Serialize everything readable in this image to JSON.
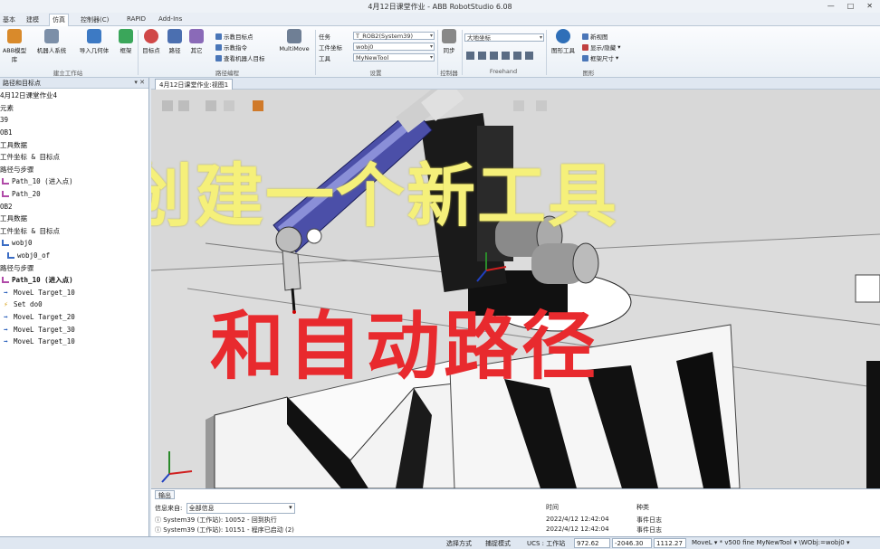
{
  "window": {
    "title": "4月12日课堂作业 - ABB RobotStudio 6.08",
    "min": "—",
    "max": "□",
    "close": "✕"
  },
  "menu_tabs": [
    "基本",
    "建模",
    "仿真",
    "控制器(C)",
    "RAPID",
    "Add-Ins"
  ],
  "ribbon": {
    "build_station": {
      "label": "建立工作站",
      "buttons": [
        "ABB模型库",
        "机器人系统",
        "导入几何体",
        "框架"
      ]
    },
    "path_programming": {
      "label": "路径编程",
      "buttons": [
        "目标点",
        "路径",
        "其它"
      ],
      "small_buttons": [
        "示教目标点",
        "示教指令",
        "查看机器人目标"
      ],
      "multimove": "MultiMove"
    },
    "settings": {
      "label": "设置",
      "fields": [
        {
          "label": "任务",
          "value": "T_ROB2(System39)"
        },
        {
          "label": "工件坐标",
          "value": "wobj0"
        },
        {
          "label": "工具",
          "value": "MyNewTool"
        }
      ]
    },
    "controller": {
      "label": "控制器",
      "button": "同步"
    },
    "freehand": {
      "label": "Freehand",
      "reference": "大地坐标"
    },
    "graphics": {
      "label": "图形",
      "button": "图形工具",
      "small_buttons": [
        "新视图",
        "显示/隐藏",
        "框架尺寸"
      ]
    }
  },
  "left_panel": {
    "title": "路径和目标点",
    "items": [
      "4月12日课堂作业4",
      "元素",
      "39",
      "OB1",
      "工具数据",
      "工件坐标 & 目标点",
      "路径与步骤",
      "Path_10 (进入点)",
      "Path_20",
      "OB2",
      "工具数据",
      "工件坐标 & 目标点",
      "wobj0",
      "wobj0_of",
      "路径与步骤",
      "Path_10 (进入点)",
      "MoveL Target_10",
      "Set do0",
      "MoveL Target_20",
      "MoveL Target_30",
      "MoveL Target_10"
    ]
  },
  "view": {
    "tab": "4月12日课堂作业:视图1",
    "overlay_line1": "创建一个新工具",
    "overlay_line2": "和自动路径"
  },
  "output": {
    "tab": "输出",
    "filter_label": "信息来自:",
    "filter_value": "全部信息",
    "col_time": "时间",
    "col_type": "种类",
    "rows": [
      {
        "msg": "System39 (工作站): 10052 - 回到执行",
        "time": "2022/4/12 12:42:04",
        "type": "事件日志"
      },
      {
        "msg": "System39 (工作站): 10151 - 程序已启动 (2)",
        "time": "2022/4/12 12:42:04",
        "type": "事件日志"
      }
    ]
  },
  "status": {
    "select_mode": "选择方式",
    "snap_mode": "捕捉模式",
    "ucs": "UCS : 工作站",
    "x": "972.62",
    "y": "-2046.30",
    "z": "1112.27",
    "instruction": "MoveL ▾ * v500 fine MyNewTool ▾ \\WObj:=wobj0 ▾"
  }
}
